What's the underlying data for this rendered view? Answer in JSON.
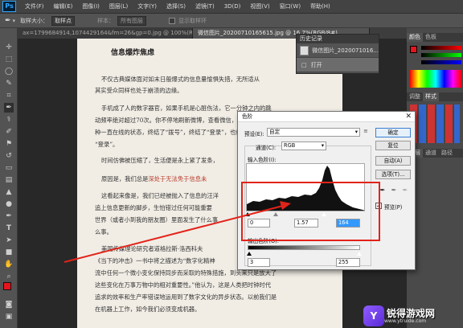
{
  "app": {
    "logo": "Ps"
  },
  "menu": [
    "文件(F)",
    "编辑(E)",
    "图像(I)",
    "图层(L)",
    "文字(Y)",
    "选择(S)",
    "滤镜(T)",
    "3D(D)",
    "视图(V)",
    "窗口(W)",
    "帮助(H)"
  ],
  "options": {
    "sample_size_label": "取样大小：",
    "sample_size_value": "取样点",
    "sample_label": "样本：",
    "sample_value": "所有图层",
    "show_ring_label": "显示取样环"
  },
  "tabs": [
    {
      "label": "ax=1799684914,1074429164&fm=26&gp=0.jpg @ 100%(RGB/8#)",
      "active": false
    },
    {
      "label": "微信图片_20200710165615.jpg @ 16.7%(RGB/8#)",
      "active": true
    }
  ],
  "history_panel": {
    "title": "历史记录",
    "rows": [
      {
        "label": "微信图片_2020071016...",
        "selected": false
      },
      {
        "label": "打开",
        "selected": true
      }
    ]
  },
  "right_tabs": {
    "color": [
      "颜色",
      "色板"
    ],
    "adjust": [
      "调整",
      "样式"
    ],
    "layers": [
      "图层",
      "通道",
      "路径"
    ]
  },
  "document": {
    "title": "信息爆炸焦虑",
    "lines": [
      "不仅古典媒体面对如末日般爆式的信息量愉惧失措，无所适从",
      "其实受众同样也处于崩溃的边缘。",
      "手机成了人的数字器官，如果手机是心脏伤法，它一分钟之内的跳",
      "动频率绝对超过70次。你不停地刷新微博，查看微信，从一只",
      "种一直在线的状态，终结了“拨号”，终结了“登录”，也终结了",
      "“登录”。",
      "时间仿佛被压缩了，生活便是永上紧了发条，",
      "原因是，我们总是深处于无法免于信息未",
      "这看起来像是，我们已经被抛入了信息的汪洋",
      "追上信息更新的脚步，生怕错过任何可能重要",
      "世界（或者小到我的朋友圈）里面发生了什么事",
      "么事。",
      "美国传媒理论研究者道格拉斯·洛西科夫",
      "《当下的冲击》一书中将之描述为“数字化精神",
      "流中任何一个微小变化保持同步而采取的特殊措施，到头来只是放大了",
      "这些变化在万事万物中的相对重要性。”他认为，这是人类把时钟时代",
      "追求的效率和生产率错误地运用到了数字文化的异步状态。以前我们是",
      "在机器上工作，如今我们必须变成机器。"
    ],
    "highlight": "深处于无法免于信息未"
  },
  "levels_dialog": {
    "title": "色阶",
    "preset_label": "预设(E):",
    "preset_value": "自定",
    "channel_label": "通道(C):",
    "channel_value": "RGB",
    "input_label": "输入色阶(I):",
    "output_label": "输出色阶(O):",
    "input_black": "0",
    "input_gamma": "1.57",
    "input_white": "164",
    "output_black": "3",
    "output_white": "255",
    "buttons": {
      "ok": "确定",
      "reset": "复位",
      "auto": "自动(A)",
      "options": "选项(T)..."
    },
    "preview_label": "预览(P)"
  },
  "watermark": {
    "mark": "Y",
    "name": "锐得游戏网",
    "url": "www.ytruide.com"
  },
  "colors": {
    "accent": "#31a8ff",
    "annotation": "#e2231a",
    "fg": "#e8141c"
  }
}
